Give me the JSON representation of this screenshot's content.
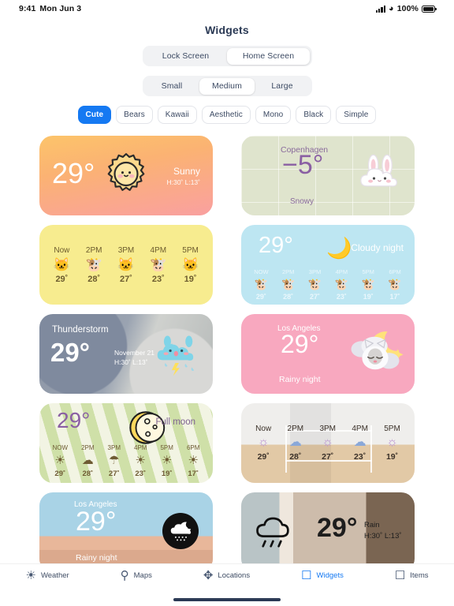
{
  "status_bar": {
    "time": "9:41",
    "date": "Mon Jun 3",
    "battery": "100%",
    "icons": {
      "signal": "signal-icon",
      "wifi": "wifi-icon",
      "battery": "battery-icon"
    }
  },
  "header": {
    "title": "Widgets"
  },
  "screen_segment": {
    "options": [
      "Lock Screen",
      "Home Screen"
    ],
    "selected": "Home Screen"
  },
  "size_segment": {
    "options": [
      "Small",
      "Medium",
      "Large"
    ],
    "selected": "Medium"
  },
  "categories": {
    "items": [
      "Cute",
      "Bears",
      "Kawaii",
      "Aesthetic",
      "Mono",
      "Black",
      "Simple"
    ],
    "selected": "Cute",
    "accent": "#1579f2"
  },
  "widgets": [
    {
      "id": "sunny-gradient",
      "temp": "29°",
      "condition": "Sunny",
      "high_low": "H:30˚ L:13˚",
      "icon": "sun-face-icon",
      "colors": {
        "from": "#fcc46a",
        "to": "#f9a0a0"
      }
    },
    {
      "id": "copenhagen-snowy",
      "city": "Copenhagen",
      "temp": "−5°",
      "condition": "Snowy",
      "icon": "bunny-cloud-icon",
      "colors": {
        "bg": "#dfe4cd",
        "text": "#8a5fa3"
      }
    },
    {
      "id": "hourly-yellow",
      "hours": [
        {
          "time": "Now",
          "icon": "cat-sunglasses-icon",
          "temp": "29˚"
        },
        {
          "time": "2PM",
          "icon": "cow-cloud-icon",
          "temp": "28˚"
        },
        {
          "time": "3PM",
          "icon": "cat-sunglasses-icon",
          "temp": "27˚"
        },
        {
          "time": "4PM",
          "icon": "cow-cloud-icon",
          "temp": "23˚"
        },
        {
          "time": "5PM",
          "icon": "cat-sunglasses-icon",
          "temp": "19˚"
        }
      ],
      "colors": {
        "bg": "#f7ec8f",
        "text": "#6c5b2e"
      }
    },
    {
      "id": "cloudy-night-blue",
      "temp": "29°",
      "condition": "Cloudy night",
      "icon": "cat-cloud-moon-icon",
      "hours": [
        {
          "time": "NOW",
          "icon": "cow-cloud-icon",
          "temp": "29˚"
        },
        {
          "time": "2PM",
          "icon": "cow-cloud-moon-icon",
          "temp": "28˚"
        },
        {
          "time": "3PM",
          "icon": "cow-cloud-moon-icon",
          "temp": "27˚"
        },
        {
          "time": "4PM",
          "icon": "cow-cloud-icon",
          "temp": "23˚"
        },
        {
          "time": "5PM",
          "icon": "cow-cloud-icon",
          "temp": "19˚"
        },
        {
          "time": "6PM",
          "icon": "cow-cloud-icon",
          "temp": "17˚"
        }
      ],
      "colors": {
        "bg": "#bde6f2"
      }
    },
    {
      "id": "thunderstorm-photo",
      "condition": "Thunderstorm",
      "temp": "29°",
      "date": "November 21",
      "high_low": "H:30˚ L:13˚",
      "icon": "cloud-lightning-face-icon"
    },
    {
      "id": "los-angeles-pink",
      "city": "Los Angeles",
      "temp": "29°",
      "condition": "Rainy night",
      "icon": "cat-cloud-moon-icon",
      "colors": {
        "bg": "#f8a8bf"
      }
    },
    {
      "id": "full-moon-green",
      "temp": "29°",
      "condition": "Full moon",
      "icon": "full-moon-icon",
      "hours": [
        {
          "time": "NOW",
          "icon": "sun-icon",
          "temp": "29˚"
        },
        {
          "time": "2PM",
          "icon": "cloud-icon",
          "temp": "28˚"
        },
        {
          "time": "3PM",
          "icon": "rain-cloud-icon",
          "temp": "27˚"
        },
        {
          "time": "4PM",
          "icon": "sun-icon",
          "temp": "23˚"
        },
        {
          "time": "5PM",
          "icon": "sun-icon",
          "temp": "19˚"
        },
        {
          "time": "6PM",
          "icon": "sun-icon",
          "temp": "17˚"
        }
      ],
      "colors": {
        "text": "#8a5fa3"
      }
    },
    {
      "id": "hourly-stairs-photo",
      "hours": [
        {
          "time": "Now",
          "icon": "sun-outline-icon",
          "temp": "29˚"
        },
        {
          "time": "2PM",
          "icon": "sun-cloud-outline-icon",
          "temp": "28˚"
        },
        {
          "time": "3PM",
          "icon": "sun-outline-icon",
          "temp": "27˚"
        },
        {
          "time": "4PM",
          "icon": "sun-cloud-outline-icon",
          "temp": "23˚"
        },
        {
          "time": "5PM",
          "icon": "sun-outline-icon",
          "temp": "19˚"
        }
      ]
    },
    {
      "id": "los-angeles-beach-photo",
      "city": "Los Angeles",
      "temp": "29°",
      "condition": "Rainy night",
      "icon": "cloud-moon-snow-badge-icon"
    },
    {
      "id": "cat-window-rain-photo",
      "temp": "29°",
      "condition": "Rain",
      "high_low": "H:30˚ L:13˚",
      "icon": "rain-cloud-outline-icon"
    }
  ],
  "tabbar": {
    "items": [
      {
        "label": "Weather",
        "icon": "weather-icon"
      },
      {
        "label": "Maps",
        "icon": "map-pin-icon"
      },
      {
        "label": "Locations",
        "icon": "location-pin-icon"
      },
      {
        "label": "Widgets",
        "icon": "widgets-phone-icon"
      },
      {
        "label": "Items",
        "icon": "items-phone-icon"
      }
    ],
    "selected": "Widgets",
    "accent": "#1579f2"
  }
}
